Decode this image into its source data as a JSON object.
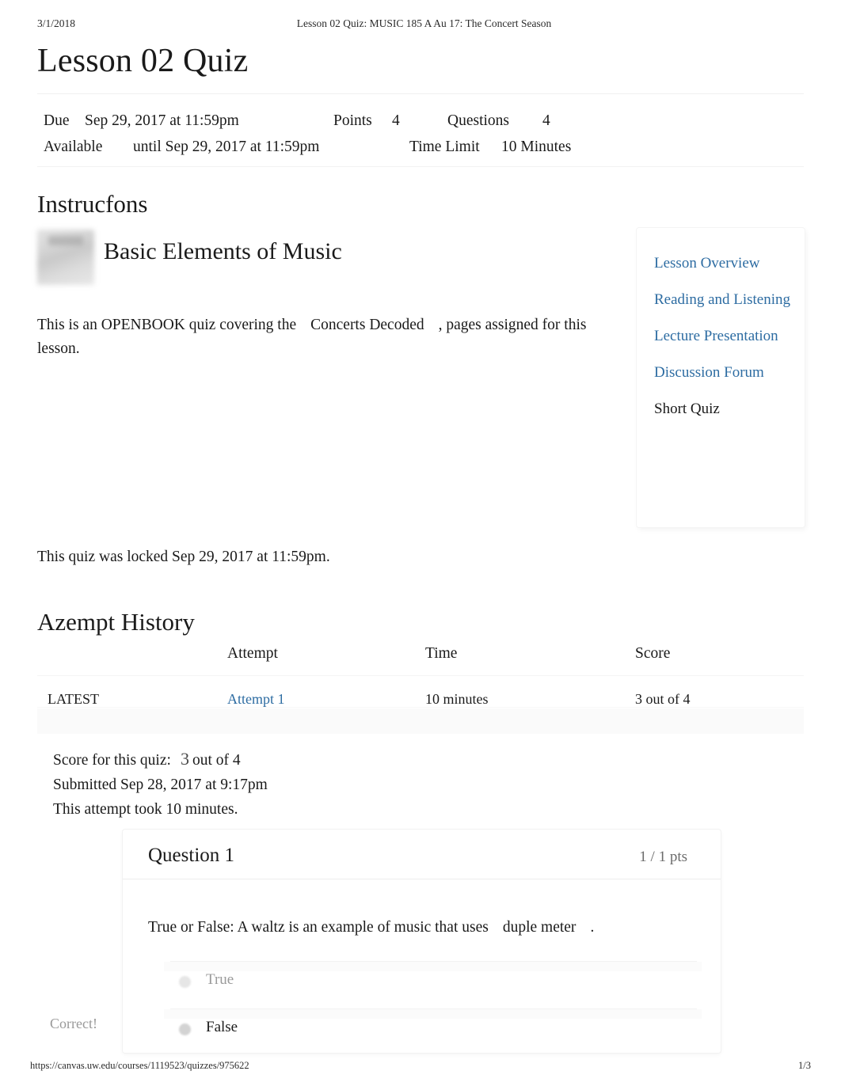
{
  "print": {
    "date": "3/1/2018",
    "doc_title": "Lesson 02 Quiz: MUSIC 185 A Au 17: The Concert Season",
    "url": "https://canvas.uw.edu/courses/1119523/quizzes/975622",
    "page_number": "1/3"
  },
  "page": {
    "title": "Lesson 02 Quiz"
  },
  "quiz_meta": {
    "due_label": "Due",
    "due_value": "Sep 29, 2017 at 11:59pm",
    "points_label": "Points",
    "points_value": "4",
    "questions_label": "Questions",
    "questions_value": "4",
    "available_label": "Available",
    "available_value": "until Sep 29, 2017 at 11:59pm",
    "time_limit_label": "Time Limit",
    "time_limit_value": "10 Minutes"
  },
  "instructions": {
    "heading": "Instrucfons",
    "subtitle": "Basic Elements of Music",
    "body_part1": "This is an OPENBOOK quiz covering the",
    "body_emphasis": "Concerts Decoded",
    "body_part2": ", pages assigned for this lesson."
  },
  "nav_box": {
    "items": [
      {
        "label": "Lesson Overview",
        "current": false
      },
      {
        "label": "Reading and Listening",
        "current": false
      },
      {
        "label": "Lecture Presentation",
        "current": false
      },
      {
        "label": "Discussion Forum",
        "current": false
      },
      {
        "label": "Short Quiz",
        "current": true
      }
    ]
  },
  "locked_notice": "This quiz was locked Sep 29, 2017 at 11:59pm.",
  "attempt_history": {
    "heading": "Azempt History",
    "columns": [
      "",
      "Attempt",
      "Time",
      "Score"
    ],
    "rows": [
      {
        "status": "LATEST",
        "attempt": "Attempt 1",
        "time": "10 minutes",
        "score": "3 out of 4"
      }
    ]
  },
  "score_summary": {
    "score_label": "Score for this quiz:",
    "score_value": "3",
    "score_suffix": "out of 4",
    "submitted": "Submitted Sep 28, 2017 at 9:17pm",
    "duration": "This attempt took 10 minutes."
  },
  "question": {
    "title": "Question 1",
    "points": "1 / 1 pts",
    "text_part1": "True or False: A waltz is an example of music that uses",
    "text_emphasis": "duple meter",
    "text_part2": ".",
    "correct_flag": "Correct!",
    "answers": [
      {
        "label": "True",
        "selected": false
      },
      {
        "label": "False",
        "selected": true
      }
    ]
  },
  "colors": {
    "link": "#2d6ca2",
    "text": "#1a1a1a",
    "muted": "#9a9a9a"
  }
}
